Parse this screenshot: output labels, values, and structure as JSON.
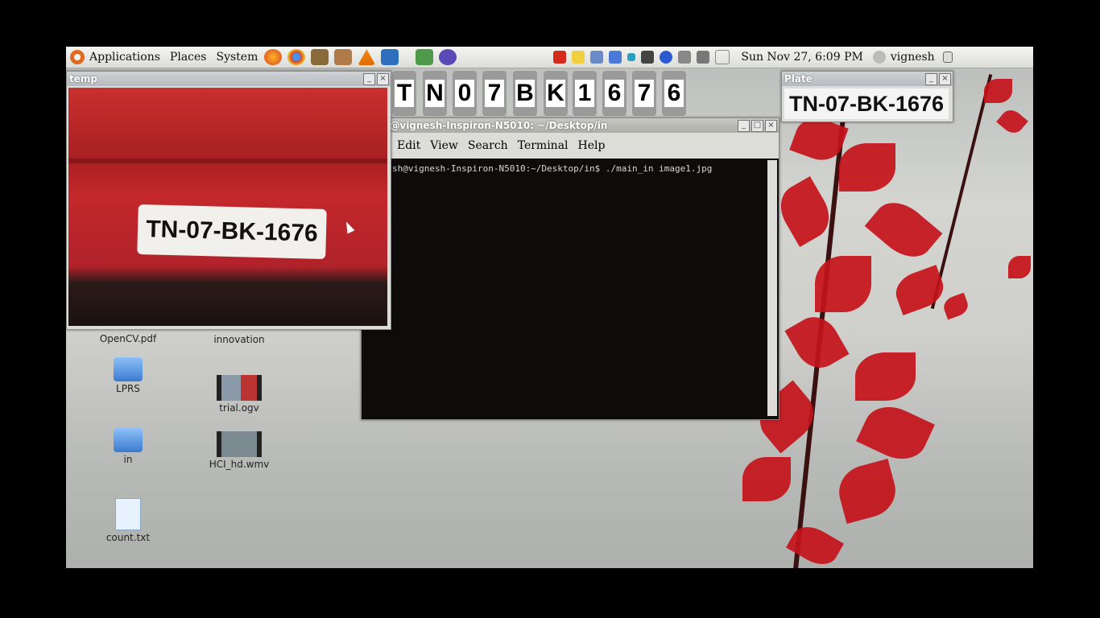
{
  "panel": {
    "menus": [
      "Applications",
      "Places",
      "System"
    ],
    "clock": "Sun Nov 27,   6:09 PM",
    "user": "vignesh",
    "launchers": [
      "firefox-icon",
      "chrome-icon",
      "archive-icon",
      "package-icon",
      "vlc-icon",
      "virtualbox-icon",
      "network-icon",
      "eclipse-icon"
    ],
    "tray": [
      "pdf-icon",
      "notes-icon",
      "image-viewer-icon",
      "brush-icon",
      "cube-icon",
      "monitor-icon",
      "bluetooth-icon",
      "battery-icon",
      "volume-icon",
      "mail-icon"
    ]
  },
  "windows": {
    "temp": {
      "title": "temp",
      "plate_text": "TN-07-BK-1676"
    },
    "plate": {
      "title": "Plate",
      "plate_text": "TN-07-BK-1676"
    },
    "chars": [
      "T",
      "N",
      "0",
      "7",
      "B",
      "K",
      "1",
      "6",
      "7",
      "6"
    ],
    "terminal": {
      "title": "nesh@vignesh-Inspiron-N5010: ~/Desktop/in",
      "menu": [
        "Edit",
        "View",
        "Search",
        "Terminal",
        "Help"
      ],
      "line": "sh@vignesh-Inspiron-N5010:~/Desktop/in$ ./main_in image1.jpg"
    }
  },
  "desktop": {
    "icons": [
      {
        "label": "OpenCV.pdf"
      },
      {
        "label": "innovation"
      },
      {
        "label": "LPRS"
      },
      {
        "label": "trial.ogv"
      },
      {
        "label": "in"
      },
      {
        "label": "HCI_hd.wmv"
      },
      {
        "label": "count.txt"
      }
    ]
  },
  "colors": {
    "panel": "#e8e8e4",
    "terminal_bg": "#0e0b0b",
    "leaves": "#c4121a",
    "car": "#b8262a"
  }
}
